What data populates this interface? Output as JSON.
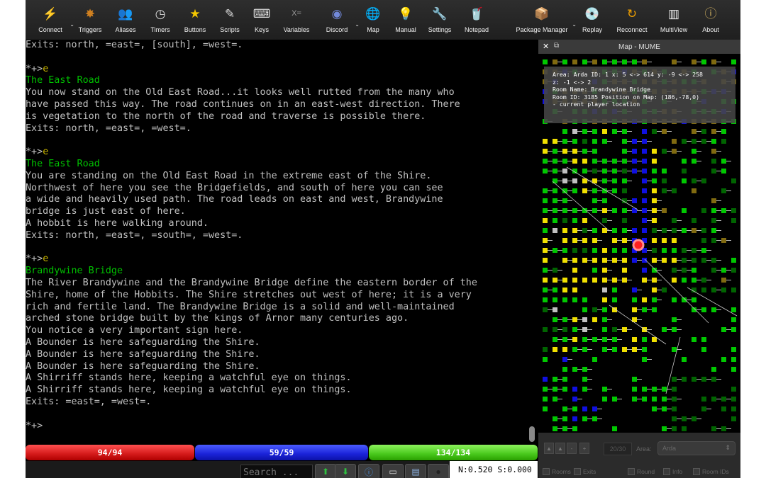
{
  "toolbar": {
    "buttons": [
      {
        "label": "Connect",
        "icon": "connect-icon",
        "glyph": "⚡",
        "color": "#f0c000",
        "caret": true
      },
      {
        "label": "Triggers",
        "icon": "triggers-icon",
        "glyph": "✸",
        "color": "#d08020",
        "caret": false
      },
      {
        "label": "Aliases",
        "icon": "aliases-icon",
        "glyph": "👥",
        "color": "#e0c080",
        "caret": false
      },
      {
        "label": "Timers",
        "icon": "timers-icon",
        "glyph": "◷",
        "color": "#dddddd",
        "caret": false
      },
      {
        "label": "Buttons",
        "icon": "buttons-icon",
        "glyph": "★",
        "color": "#f5c800",
        "caret": false
      },
      {
        "label": "Scripts",
        "icon": "scripts-icon",
        "glyph": "✎",
        "color": "#dddddd",
        "caret": false
      },
      {
        "label": "Keys",
        "icon": "keys-icon",
        "glyph": "⌨",
        "color": "#dddddd",
        "caret": false
      },
      {
        "label": "Variables",
        "icon": "variables-icon",
        "glyph": "X=",
        "color": "#999999",
        "caret": false
      },
      {
        "label": "Discord",
        "icon": "discord-icon",
        "glyph": "◉",
        "color": "#7289da",
        "caret": true
      },
      {
        "label": "Map",
        "icon": "map-icon",
        "glyph": "🌐",
        "color": "#3a70d0",
        "caret": false
      },
      {
        "label": "Manual",
        "icon": "manual-icon",
        "glyph": "💡",
        "color": "#f0c840",
        "caret": false
      },
      {
        "label": "Settings",
        "icon": "settings-icon",
        "glyph": "🔧",
        "color": "#bbbbbb",
        "caret": false
      },
      {
        "label": "Notepad",
        "icon": "notepad-icon",
        "glyph": "🥤",
        "color": "#dddddd",
        "caret": false
      },
      {
        "label": "Package Manager",
        "icon": "package-manager-icon",
        "glyph": "📦",
        "color": "#c08040",
        "caret": true
      },
      {
        "label": "Replay",
        "icon": "replay-icon",
        "glyph": "💿",
        "color": "#dddddd",
        "caret": false
      },
      {
        "label": "Reconnect",
        "icon": "reconnect-icon",
        "glyph": "↻",
        "color": "#f0a000",
        "caret": false
      },
      {
        "label": "MultiView",
        "icon": "multiview-icon",
        "glyph": "▥",
        "color": "#eeeeee",
        "caret": false
      },
      {
        "label": "About",
        "icon": "about-icon",
        "glyph": "ⓘ",
        "color": "#d0b060",
        "caret": false
      }
    ]
  },
  "console": {
    "lines": [
      {
        "type": "text",
        "text": "Exits: north, =east=, [south], =west=."
      },
      {
        "type": "blank",
        "text": ""
      },
      {
        "type": "prompt",
        "text": "*+>",
        "cmd": "e"
      },
      {
        "type": "title",
        "text": "The East Road"
      },
      {
        "type": "text",
        "text": "You now stand on the Old East Road...it looks well rutted from the many who"
      },
      {
        "type": "text",
        "text": "have passed this way. The road continues on in an east-west direction. There"
      },
      {
        "type": "text",
        "text": "is vegetation to the north of the road and traverse is possible there."
      },
      {
        "type": "text",
        "text": "Exits: north, =east=, =west=."
      },
      {
        "type": "blank",
        "text": ""
      },
      {
        "type": "prompt",
        "text": "*+>",
        "cmd": "e"
      },
      {
        "type": "title",
        "text": "The East Road"
      },
      {
        "type": "text",
        "text": "You are standing on the Old East Road in the extreme east of the Shire."
      },
      {
        "type": "text",
        "text": "Northwest of here you see the Bridgefields, and south of here you can see"
      },
      {
        "type": "text",
        "text": "a wide and heavily used path. The road leads on east and west, Brandywine"
      },
      {
        "type": "text",
        "text": "bridge is just east of here."
      },
      {
        "type": "text",
        "text": "A hobbit is here walking around."
      },
      {
        "type": "text",
        "text": "Exits: north, =east=, =south=, =west=."
      },
      {
        "type": "blank",
        "text": ""
      },
      {
        "type": "prompt",
        "text": "*+>",
        "cmd": "e"
      },
      {
        "type": "title",
        "text": "Brandywine Bridge"
      },
      {
        "type": "text",
        "text": "The River Brandywine and the Brandywine Bridge define the eastern border of the"
      },
      {
        "type": "text",
        "text": "Shire, home of the Hobbits. The Shire stretches out west of here; it is a very"
      },
      {
        "type": "text",
        "text": "rich and fertile land. The Brandywine Bridge is a solid and well-maintained"
      },
      {
        "type": "text",
        "text": "arched stone bridge built by the kings of Arnor many centuries ago."
      },
      {
        "type": "text",
        "text": "You notice a very important sign here."
      },
      {
        "type": "text",
        "text": "A Bounder is here safeguarding the Shire."
      },
      {
        "type": "text",
        "text": "A Bounder is here safeguarding the Shire."
      },
      {
        "type": "text",
        "text": "A Bounder is here safeguarding the Shire."
      },
      {
        "type": "text",
        "text": "A Shirriff stands here, keeping a watchful eye on things."
      },
      {
        "type": "text",
        "text": "A Shirriff stands here, keeping a watchful eye on things."
      },
      {
        "type": "text",
        "text": "Exits: =east=, =west=."
      },
      {
        "type": "blank",
        "text": ""
      },
      {
        "type": "prompt",
        "text": "*+>",
        "cmd": ""
      }
    ]
  },
  "gauges": {
    "hp": {
      "text": "94/94",
      "current": 94,
      "max": 94,
      "color": "#d41a1a"
    },
    "mana": {
      "text": "59/59",
      "current": 59,
      "max": 59,
      "color": "#1a22d8"
    },
    "moves": {
      "text": "134/134",
      "current": 134,
      "max": 134,
      "color": "#48c81c"
    }
  },
  "bottombar": {
    "search_placeholder": "Search ...",
    "buttons": [
      {
        "name": "scroll-up-button",
        "icon": "up-arrow-icon",
        "glyph": "⬆",
        "color": "#2ec040"
      },
      {
        "name": "scroll-down-button",
        "icon": "down-arrow-icon",
        "glyph": "⬇",
        "color": "#2ec040"
      },
      {
        "name": "info-button",
        "icon": "info-icon",
        "glyph": "ⓘ",
        "color": "#4a90e0"
      },
      {
        "name": "timestamp-button",
        "icon": "tape-icon",
        "glyph": "▭",
        "color": "#dddddd"
      },
      {
        "name": "log-button",
        "icon": "log-icon",
        "glyph": "▤",
        "color": "#8ab0e0"
      },
      {
        "name": "record-button",
        "icon": "record-icon",
        "glyph": "●",
        "color": "#222222"
      }
    ],
    "lag_readout": "N:0.520 S:0.000"
  },
  "map": {
    "window_title": "Map - MUME",
    "info_lines": [
      "Area: Arda ID: 1 x: 5 <-> 614 y: -9 <-> 258",
      "z: -1 <-> 2",
      "Room Name: Brandywine Bridge",
      "Room ID: 3185 Position on Map: (186,-78,0)",
      "- current player location"
    ],
    "colors": {
      "road": "#f0e000",
      "field": "#00c800",
      "forest": "#006400",
      "water": "#1010e0",
      "brown": "#806a10",
      "stone": "#c0c0c0",
      "player": "#ff2020"
    },
    "zoom_value": "20/30",
    "area_label": "Area:",
    "area_value": "Arda",
    "checkboxes": [
      {
        "label": "Rooms"
      },
      {
        "label": "Exits"
      },
      {
        "label": "Round"
      },
      {
        "label": "Info"
      },
      {
        "label": "Room IDs"
      }
    ]
  }
}
